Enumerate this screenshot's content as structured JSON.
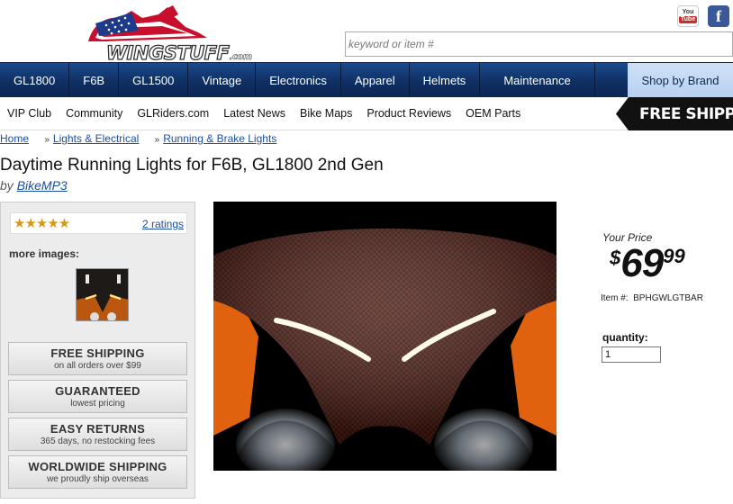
{
  "header": {
    "logo_text": "WINGSTUFF",
    "logo_suffix": ".com",
    "search_placeholder": "keyword or item #",
    "youtube_label": "You",
    "youtube_tube": "Tube",
    "facebook_label": "f"
  },
  "main_nav": {
    "items": [
      "GL1800",
      "F6B",
      "GL1500",
      "Vintage",
      "Electronics",
      "Apparel",
      "Helmets",
      "Maintenance"
    ],
    "shop_by_brand": "Shop by Brand"
  },
  "sub_nav": {
    "items": [
      "VIP Club",
      "Community",
      "GLRiders.com",
      "Latest News",
      "Bike Maps",
      "Product Reviews",
      "OEM Parts"
    ],
    "banner": "FREE SHIPPI"
  },
  "breadcrumb": {
    "home": "Home",
    "level1": "Lights & Electrical",
    "level2": "Running & Brake Lights",
    "separator": "»"
  },
  "product": {
    "title": "Daytime Running Lights for F6B, GL1800 2nd Gen",
    "by_prefix": "by",
    "brand": "BikeMP3",
    "stars": "★★★★★",
    "ratings_link": "2 ratings",
    "more_images": "more images:",
    "rating": 5
  },
  "features": [
    {
      "title": "FREE SHIPPING",
      "sub": "on all orders over $99"
    },
    {
      "title": "GUARANTEED",
      "sub": "lowest pricing"
    },
    {
      "title": "EASY RETURNS",
      "sub": "365 days, no restocking fees"
    },
    {
      "title": "WORLDWIDE SHIPPING",
      "sub": "we proudly ship overseas"
    }
  ],
  "pricing": {
    "your_price_label": "Your Price",
    "currency": "$",
    "dollars": "69",
    "cents": "99",
    "item_label": "Item #:",
    "item_number": "BPHGWLGTBAR",
    "quantity_label": "quantity:",
    "quantity_value": "1"
  },
  "colors": {
    "nav_blue": "#0f2f62",
    "shop_brand_bg": "#cfe1f7",
    "link_blue": "#1b4fa0",
    "star_gold": "#d59a1a",
    "fairing_orange": "#e0620f"
  }
}
